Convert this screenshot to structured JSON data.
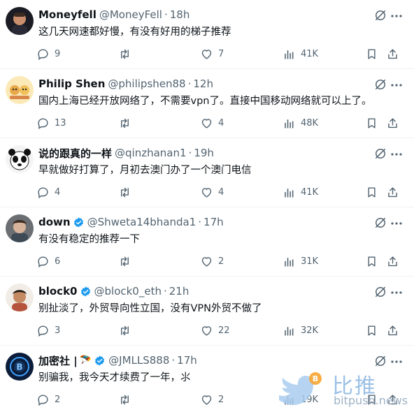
{
  "colors": {
    "accent": "#1d9bf0",
    "muted": "#536471",
    "border": "#eff3f4"
  },
  "tweets": [
    {
      "name": "Moneyfell",
      "handle": "@MoneyFell",
      "time": "18h",
      "verified": false,
      "flag": "",
      "text": "这几天网速都好慢，有没有好用的梯子推荐",
      "replies": "9",
      "retweets": "",
      "likes": "7",
      "views": "41K"
    },
    {
      "name": "Philip Shen",
      "handle": "@philipshen88",
      "time": "12h",
      "verified": false,
      "flag": "",
      "text": "国内上海已经开放网络了，不需要vpn了。直接中国移动网络就可以上了。",
      "replies": "13",
      "retweets": "",
      "likes": "4",
      "views": "48K"
    },
    {
      "name": "说的跟真的一样",
      "handle": "@qinzhanan1",
      "time": "19h",
      "verified": false,
      "flag": "",
      "text": "早就做好打算了，月初去澳门办了一个澳门电信",
      "replies": "4",
      "retweets": "",
      "likes": "4",
      "views": "41K"
    },
    {
      "name": "down",
      "handle": "@Shweta14bhanda1",
      "time": "17h",
      "verified": true,
      "flag": "",
      "text": "有没有稳定的推荐一下",
      "replies": "6",
      "retweets": "",
      "likes": "2",
      "views": "31K"
    },
    {
      "name": "block0",
      "handle": "@block0_eth",
      "time": "21h",
      "verified": true,
      "flag": "",
      "text": "别扯淡了，外贸导向性立国，没有VPN外贸不做了",
      "replies": "3",
      "retweets": "",
      "likes": "22",
      "views": "32K"
    },
    {
      "name": "加密社 |",
      "handle": "@JMLLS888",
      "time": "17h",
      "verified": true,
      "flag": "🪂",
      "text": "别骗我，我今天才续费了一年，⺢",
      "replies": "2",
      "retweets": "",
      "likes": "2",
      "views": "19K"
    }
  ],
  "icons": {
    "reply": "reply-icon",
    "retweet": "retweet-icon",
    "like": "heart-icon",
    "views": "views-icon",
    "bookmark": "bookmark-icon",
    "share": "share-icon",
    "mute": "mute-icon",
    "more": "more-icon",
    "verified": "verified-badge-icon"
  },
  "watermark": {
    "cn": "比推",
    "en": "bitpush.news"
  }
}
